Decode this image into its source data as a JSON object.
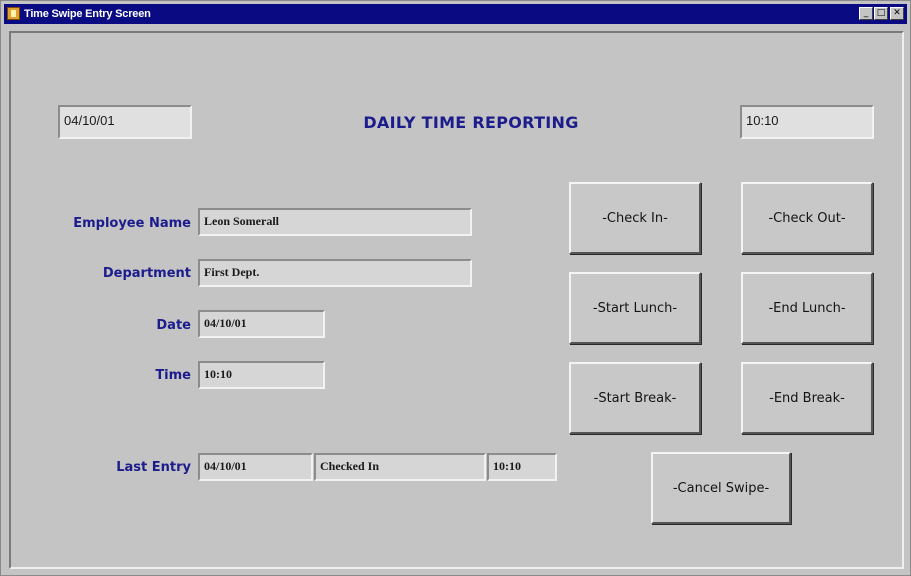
{
  "window": {
    "title": "Time Swipe Entry Screen",
    "controls": {
      "minimize": "_",
      "maximize": "□",
      "close": "✕"
    }
  },
  "header": {
    "date": "04/10/01",
    "heading": "DAILY TIME REPORTING",
    "time": "10:10"
  },
  "form": {
    "employee_name_label": "Employee Name",
    "employee_name": "Leon Somerall",
    "department_label": "Department",
    "department": "First Dept.",
    "date_label": "Date",
    "date": "04/10/01",
    "time_label": "Time",
    "time": "10:10"
  },
  "last_entry": {
    "label": "Last Entry",
    "date": "04/10/01",
    "status": "Checked In",
    "time": "10:10"
  },
  "buttons": {
    "check_in": "-Check In-",
    "check_out": "-Check Out-",
    "start_lunch": "-Start Lunch-",
    "end_lunch": "-End Lunch-",
    "start_break": "-Start Break-",
    "end_break": "-End Break-",
    "cancel_swipe": "-Cancel Swipe-"
  },
  "colors": {
    "titlebar": "#0a0a82",
    "label_text": "#1c1c8c",
    "background": "#c4c4c4"
  }
}
